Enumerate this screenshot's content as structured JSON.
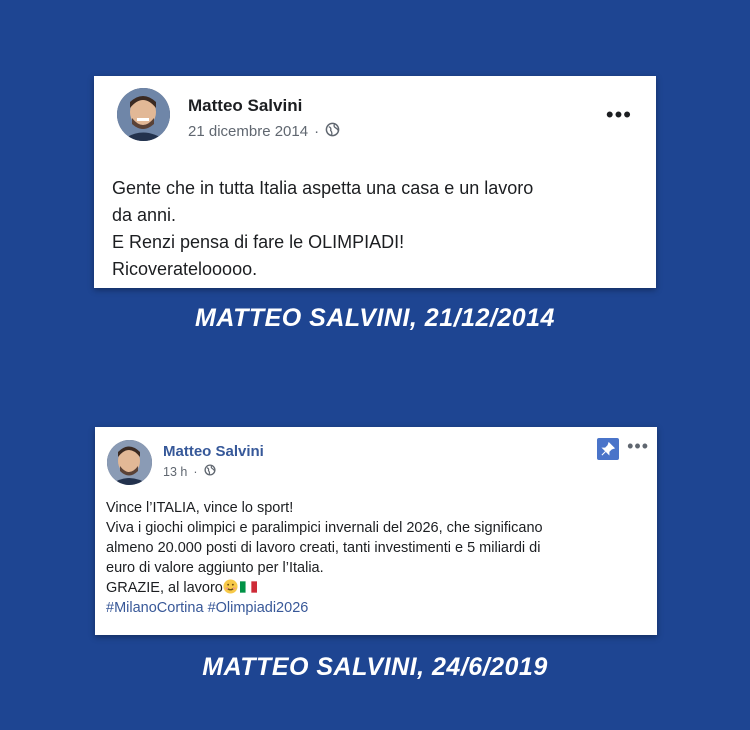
{
  "post1": {
    "author": "Matteo Salvini",
    "date": "21 dicembre 2014",
    "separator": "·",
    "privacy_icon": "globe-icon",
    "more_label": "•••",
    "lines": [
      "Gente che in tutta Italia aspetta una casa e un lavoro",
      "da anni.",
      "E Renzi pensa di fare le OLIMPIADI!",
      "Ricoveratelooooo."
    ]
  },
  "caption1": "MATTEO SALVINI, 21/12/2014",
  "post2": {
    "author": "Matteo Salvini",
    "time": "13 h",
    "separator": "·",
    "privacy_icon": "globe-icon",
    "pin_icon": "pin-icon",
    "more_label": "•••",
    "lines": [
      "Vince l’ITALIA, vince lo sport!",
      "Viva i giochi olimpici e paralimpici invernali del 2026, che significano",
      "almeno 20.000 posti di lavoro creati, tanti investimenti e 5 miliardi di",
      "euro di valore aggiunto per l’Italia."
    ],
    "grazie": "GRAZIE, al lavoro",
    "emoji": [
      "smiling-face-icon",
      "italian-flag-icon"
    ],
    "hashtags": [
      "#MilanoCortina",
      "#Olimpiadi2026"
    ]
  },
  "caption2": "MATTEO SALVINI, 24/6/2019",
  "colors": {
    "background": "#1e4592",
    "card": "#ffffff",
    "link": "#385898"
  }
}
